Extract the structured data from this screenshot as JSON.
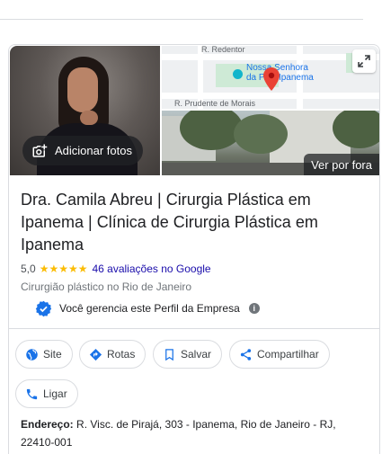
{
  "photos": {
    "add_photos_label": "Adicionar fotos",
    "see_outside_label": "Ver por fora",
    "map": {
      "street_1": "R. Redentor",
      "place_line_1": "Nossa Senhora",
      "place_line_2": "da P... / Ipanema",
      "street_2": "R. Prudente de Morais"
    }
  },
  "business": {
    "name": "Dra. Camila Abreu | Cirurgia Plástica em Ipanema | Clínica de Cirurgia Plástica em Ipanema",
    "rating": "5,0",
    "stars": "★★★★★",
    "reviews_text": "46 avaliações no Google",
    "category": "Cirurgião plástico no Rio de Janeiro",
    "verified_text": "Você gerencia este Perfil da Empresa"
  },
  "actions": {
    "site": "Site",
    "routes": "Rotas",
    "save": "Salvar",
    "share": "Compartilhar",
    "call": "Ligar"
  },
  "address": {
    "label": "Endereço:",
    "value": "R. Visc. de Pirajá, 303 - Ipanema, Rio de Janeiro - RJ, 22410-001"
  },
  "colors": {
    "accent_blue": "#1a73e8",
    "link_blue": "#1a0dab",
    "star_yellow": "#fbbc04",
    "pin_red": "#ea4335"
  }
}
